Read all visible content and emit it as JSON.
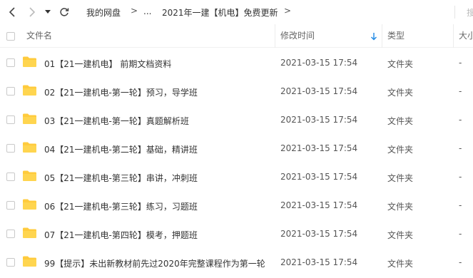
{
  "toolbar": {
    "back_icon": "chevron-left-icon",
    "forward_icon": "chevron-right-icon",
    "history_icon": "caret-down-icon",
    "refresh_icon": "refresh-icon",
    "breadcrumb": {
      "root": "我的网盘",
      "sep1": ">",
      "ellipsis": "...",
      "current": "2021年一建【机电】免费更新",
      "sep2": ">"
    },
    "search_partial": "搜"
  },
  "columns": {
    "name": "文件名",
    "modified": "修改时间",
    "type": "类型",
    "size": "大小"
  },
  "files": [
    {
      "name": "01【21一建机电】 前期文档资料",
      "modified": "2021-03-15 17:54",
      "type": "文件夹",
      "size": "-"
    },
    {
      "name": "02【21一建机电-第一轮】预习，导学班",
      "modified": "2021-03-15 17:54",
      "type": "文件夹",
      "size": "-"
    },
    {
      "name": "03【21一建机电-第一轮】真题解析班",
      "modified": "2021-03-15 17:54",
      "type": "文件夹",
      "size": "-"
    },
    {
      "name": "04【21一建机电-第二轮】基础，精讲班",
      "modified": "2021-03-15 17:54",
      "type": "文件夹",
      "size": "-"
    },
    {
      "name": "05【21一建机电-第三轮】串讲，冲刺班",
      "modified": "2021-03-15 17:54",
      "type": "文件夹",
      "size": "-"
    },
    {
      "name": "06【21一建机电-第三轮】练习，习题班",
      "modified": "2021-03-15 17:54",
      "type": "文件夹",
      "size": "-"
    },
    {
      "name": "07【21一建机电-第四轮】模考，押题班",
      "modified": "2021-03-15 17:54",
      "type": "文件夹",
      "size": "-"
    },
    {
      "name": "99【提示】未出新教材前先过2020年完整课程作为第一轮",
      "modified": "2021-03-15 17:54",
      "type": "文件夹",
      "size": "-"
    }
  ],
  "colors": {
    "folder": "#FFCB3D",
    "sort_arrow": "#1E88E5"
  }
}
